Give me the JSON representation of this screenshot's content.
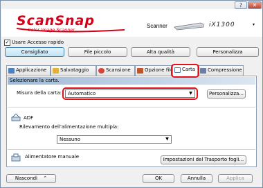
{
  "window": {
    "help_button": "?",
    "close_button": "✕"
  },
  "header": {
    "logo_main": "ScanSnap",
    "logo_sub": "Color Image Scanner",
    "scanner_label": "Scanner",
    "scanner_model": "iX1300",
    "scanner_dropdown": "▾"
  },
  "quick_menu": {
    "checkbox_label": "Usare Accesso rapido",
    "checked": true
  },
  "presets": [
    "Consigliato",
    "File piccolo",
    "Alta qualità",
    "Personalizza"
  ],
  "tabs": [
    "Applicazione",
    "Salvataggio",
    "Scansione",
    "Opzione file",
    "Carta",
    "Compressione"
  ],
  "selected_tab": "Carta",
  "paper": {
    "section_title": "Selezionare la carta.",
    "size_label": "Misura della carta:",
    "size_value": "Automatico",
    "customize_button": "Personalizza..."
  },
  "adf": {
    "title": "ADF",
    "multifeed_label": "Rilevamento dell'alimentazione multipla:",
    "multifeed_value": "Nessuno"
  },
  "manual": {
    "title": "Alimentatore manuale",
    "carrier_button": "Impostazioni del Trasporto fogli..."
  },
  "footer": {
    "hide_button": "Nascondi",
    "hide_arrow": "⌃",
    "ok": "OK",
    "cancel": "Annulla",
    "apply": "Applica"
  },
  "colors": {
    "logo_red": "#d4001a",
    "highlight_red": "#e2101a",
    "section_blue": "#9fb9d7"
  }
}
